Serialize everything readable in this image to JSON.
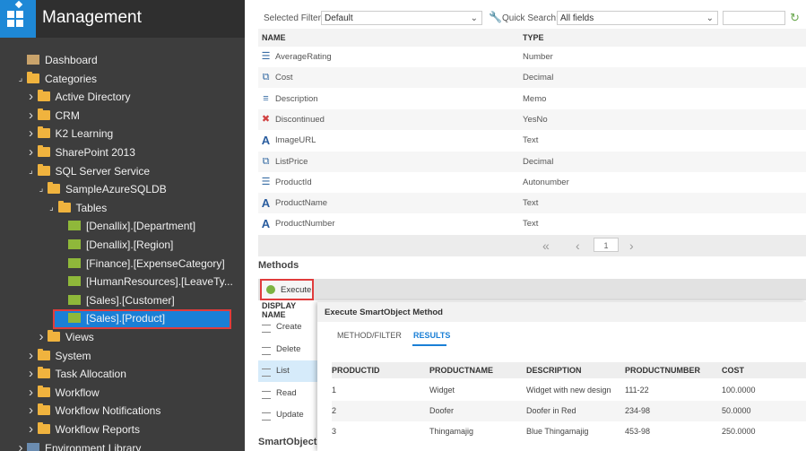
{
  "app": {
    "title": "Management"
  },
  "tree": [
    {
      "label": "Dashboard",
      "icon": "dashboard-icon",
      "arrow": ""
    },
    {
      "label": "Categories",
      "icon": "folder-icon",
      "arrow": "expanded"
    },
    {
      "label": "Active Directory",
      "icon": "folder-icon",
      "arrow": "collapsed"
    },
    {
      "label": "CRM",
      "icon": "folder-icon",
      "arrow": "collapsed"
    },
    {
      "label": "K2 Learning",
      "icon": "folder-icon",
      "arrow": "collapsed"
    },
    {
      "label": "SharePoint 2013",
      "icon": "folder-icon",
      "arrow": "collapsed"
    },
    {
      "label": "SQL Server Service",
      "icon": "folder-icon",
      "arrow": "expanded"
    },
    {
      "label": "SampleAzureSQLDB",
      "icon": "folder-icon",
      "arrow": "expanded"
    },
    {
      "label": "Tables",
      "icon": "folder-icon",
      "arrow": "expanded"
    },
    {
      "label": "[Denallix].[Department]",
      "icon": "smartobject-icon",
      "arrow": ""
    },
    {
      "label": "[Denallix].[Region]",
      "icon": "smartobject-icon",
      "arrow": ""
    },
    {
      "label": "[Finance].[ExpenseCategory]",
      "icon": "smartobject-icon",
      "arrow": ""
    },
    {
      "label": "[HumanResources].[LeaveTy...",
      "icon": "smartobject-icon",
      "arrow": ""
    },
    {
      "label": "[Sales].[Customer]",
      "icon": "smartobject-icon",
      "arrow": ""
    },
    {
      "label": "[Sales].[Product]",
      "icon": "smartobject-icon",
      "arrow": "",
      "selected": true
    },
    {
      "label": "Views",
      "icon": "folder-icon",
      "arrow": "collapsed"
    },
    {
      "label": "System",
      "icon": "folder-icon",
      "arrow": "collapsed"
    },
    {
      "label": "Task Allocation",
      "icon": "folder-icon",
      "arrow": "collapsed"
    },
    {
      "label": "Workflow",
      "icon": "folder-icon",
      "arrow": "collapsed"
    },
    {
      "label": "Workflow Notifications",
      "icon": "folder-icon",
      "arrow": "collapsed"
    },
    {
      "label": "Workflow Reports",
      "icon": "folder-icon",
      "arrow": "collapsed"
    },
    {
      "label": "Environment Library",
      "icon": "library-icon",
      "arrow": "collapsed"
    }
  ],
  "filter": {
    "selected_filter_label": "Selected Filter:",
    "selected_filter_value": "Default",
    "quick_search_label": "Quick Search:",
    "quick_search_value": "All fields",
    "search_text": ""
  },
  "properties": {
    "columns": [
      "NAME",
      "TYPE"
    ],
    "rows": [
      {
        "name": "AverageRating",
        "type": "Number",
        "icon": "number-icon"
      },
      {
        "name": "Cost",
        "type": "Decimal",
        "icon": "decimal-icon"
      },
      {
        "name": "Description",
        "type": "Memo",
        "icon": "memo-icon"
      },
      {
        "name": "Discontinued",
        "type": "YesNo",
        "icon": "yesno-icon"
      },
      {
        "name": "ImageURL",
        "type": "Text",
        "icon": "text-icon"
      },
      {
        "name": "ListPrice",
        "type": "Decimal",
        "icon": "decimal-icon"
      },
      {
        "name": "ProductId",
        "type": "Autonumber",
        "icon": "autonumber-icon"
      },
      {
        "name": "ProductName",
        "type": "Text",
        "icon": "text-icon"
      },
      {
        "name": "ProductNumber",
        "type": "Text",
        "icon": "text-icon"
      }
    ]
  },
  "pager": {
    "page": "1"
  },
  "methods": {
    "title": "Methods",
    "execute_label": "Execute",
    "display_name_header": "DISPLAY NAME",
    "items": [
      "Create",
      "Delete",
      "List",
      "Read",
      "Update"
    ],
    "active_index": 2
  },
  "smartobject_section_title": "SmartObject S",
  "dialog": {
    "title": "Execute SmartObject Method",
    "tabs": [
      "METHOD/FILTER",
      "RESULTS"
    ],
    "active_tab": 1,
    "columns": [
      "PRODUCTID",
      "PRODUCTNAME",
      "DESCRIPTION",
      "PRODUCTNUMBER",
      "COST"
    ],
    "rows": [
      [
        "1",
        "Widget",
        "Widget with new design",
        "111-22",
        "100.0000"
      ],
      [
        "2",
        "Doofer",
        "Doofer in Red",
        "234-98",
        "50.0000"
      ],
      [
        "3",
        "Thingamajig",
        "Blue Thingamajig",
        "453-98",
        "250.0000"
      ]
    ]
  },
  "colors": {
    "sidebar_bg": "#3d3d3d",
    "accent_blue": "#1a7fd6",
    "highlight_red": "#e03c3c"
  }
}
